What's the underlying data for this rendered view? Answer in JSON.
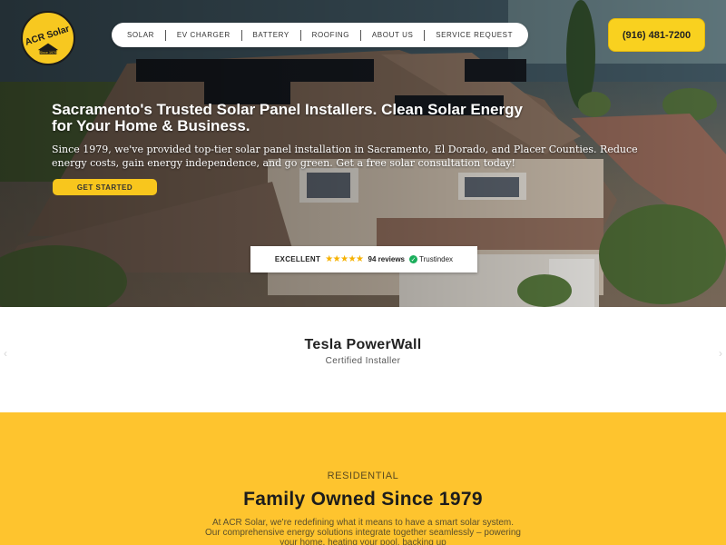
{
  "brand": {
    "logo_text": "ACR Solar",
    "logo_since": "Since 1979",
    "accent": "#f9d11f"
  },
  "nav": {
    "items": [
      {
        "label": "SOLAR"
      },
      {
        "label": "EV CHARGER"
      },
      {
        "label": "BATTERY"
      },
      {
        "label": "ROOFING"
      },
      {
        "label": "ABOUT US"
      },
      {
        "label": "SERVICE REQUEST"
      }
    ]
  },
  "phone": {
    "label": "(916) 481-7200"
  },
  "hero": {
    "title": "Sacramento's Trusted Solar Panel Installers. Clean Solar Energy for Your Home & Business.",
    "text": "Since 1979, we've provided top-tier solar panel installation in Sacramento, El Dorado, and Placer Counties. Reduce energy costs, gain energy independence, and go green. Get a free solar consultation today!",
    "cta": "GET STARTED"
  },
  "review": {
    "rating_word": "EXCELLENT",
    "stars": "★★★★★",
    "count": "94 reviews",
    "provider": "Trustindex",
    "provider_icon": "check-icon"
  },
  "partner": {
    "title": "Tesla PowerWall",
    "subtitle": "Certified Installer",
    "prev_icon": "chevron-left-icon",
    "next_icon": "chevron-right-icon"
  },
  "about": {
    "eyebrow": "RESIDENTIAL",
    "heading": "Family Owned Since 1979",
    "body": "At ACR Solar, we're redefining what it means to have a smart solar system. Our comprehensive energy solutions integrate together seamlessly – powering your home, heating your pool, backing up",
    "background": "#fec42e"
  }
}
